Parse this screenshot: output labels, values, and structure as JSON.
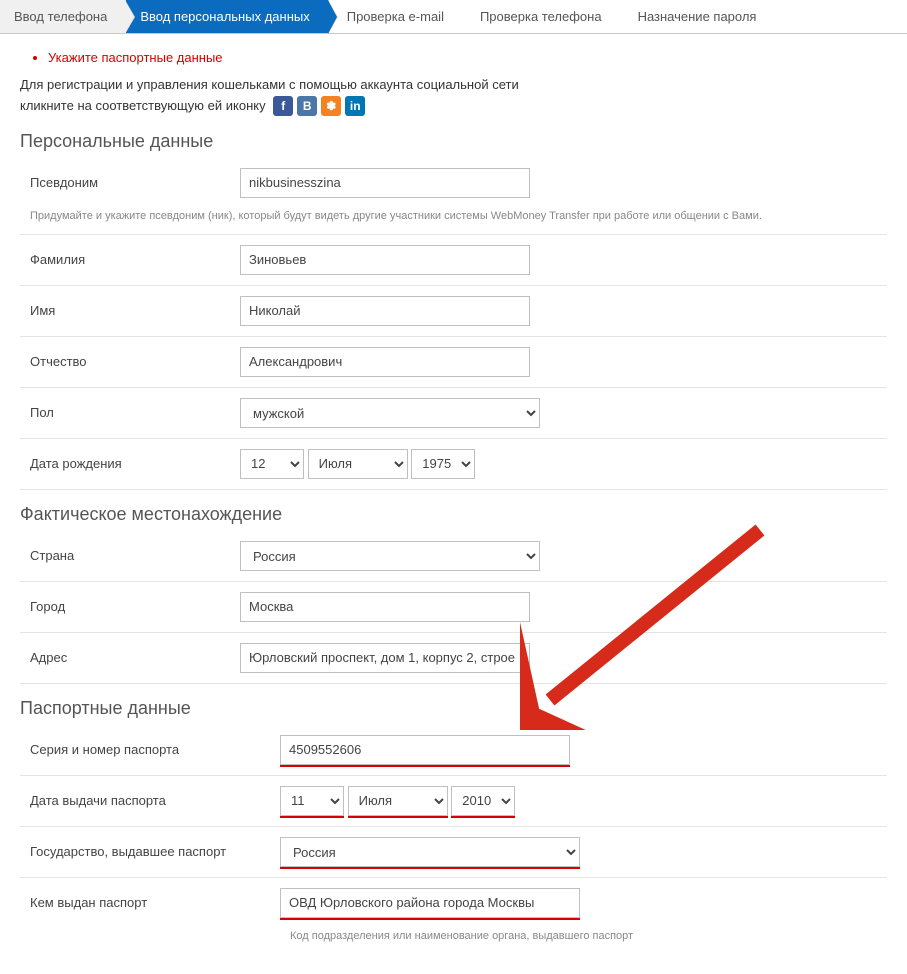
{
  "steps": {
    "s1": "Ввод телефона",
    "s2": "Ввод персональных данных",
    "s3": "Проверка e-mail",
    "s4": "Проверка телефона",
    "s5": "Назначение пароля"
  },
  "errors": {
    "e1": "Укажите паспортные данные"
  },
  "intro": {
    "line1": "Для регистрации и управления кошельками с помощью аккаунта социальной сети",
    "line2_prefix": "кликните на соответствующую ей иконку"
  },
  "social": {
    "fb": "f",
    "vk": "B",
    "ok": "✽",
    "li": "in"
  },
  "sections": {
    "personal": "Персональные данные",
    "location": "Фактическое местонахождение",
    "passport": "Паспортные данные"
  },
  "labels": {
    "nick": "Псевдоним",
    "nick_hint": "Придумайте и укажите псевдоним (ник), который будут видеть другие участники системы WebMoney Transfer при работе или общении с Вами.",
    "lastname": "Фамилия",
    "firstname": "Имя",
    "patronymic": "Отчество",
    "sex": "Пол",
    "dob": "Дата рождения",
    "country": "Страна",
    "city": "Город",
    "address": "Адрес",
    "passport_no": "Серия и номер паспорта",
    "passport_date": "Дата выдачи паспорта",
    "passport_country": "Государство, выдавшее паспорт",
    "passport_issuer": "Кем выдан паспорт",
    "passport_issuer_hint": "Код подразделения или наименование органа, выдавшего паспорт"
  },
  "values": {
    "nick": "nikbusinesszina",
    "lastname": "Зиновьев",
    "firstname": "Николай",
    "patronymic": "Александрович",
    "sex": "мужской",
    "dob_day": "12",
    "dob_month": "Июля",
    "dob_year": "1975",
    "country": "Россия",
    "city": "Москва",
    "address": "Юрловский проспект, дом 1, корпус 2, строе",
    "passport_no": "4509552606",
    "passport_day": "11",
    "passport_month": "Июля",
    "passport_year": "2010",
    "passport_country": "Россия",
    "passport_issuer": "ОВД Юрловского района города Москвы"
  },
  "colors": {
    "accent": "#0a6bbf",
    "error": "#d60000",
    "highlight": "#d60000"
  }
}
